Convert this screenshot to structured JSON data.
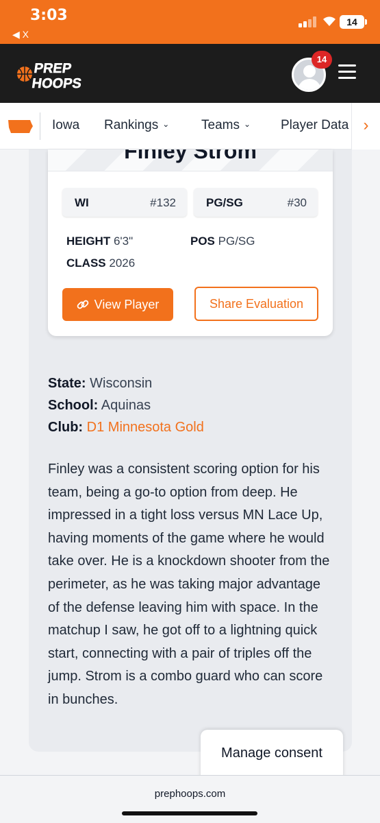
{
  "status_bar": {
    "time": "3:03",
    "back_label": "◀ X",
    "battery": "14"
  },
  "header": {
    "logo_line1": "PREP",
    "logo_line2": "HOOPS",
    "notification_count": "14"
  },
  "nav": {
    "items": [
      {
        "label": "Iowa",
        "has_dropdown": false
      },
      {
        "label": "Rankings",
        "has_dropdown": true
      },
      {
        "label": "Teams",
        "has_dropdown": true
      },
      {
        "label": "Player Data",
        "has_dropdown": false
      }
    ],
    "chevron": "›"
  },
  "player_card": {
    "name": "Finley Strom",
    "state_abbr": "WI",
    "state_rank": "#132",
    "position_label": "PG/SG",
    "position_rank": "#30",
    "height_label": "HEIGHT",
    "height_value": "6'3\"",
    "class_label": "CLASS",
    "class_value": "2026",
    "pos_label": "POS",
    "pos_value": "PG/SG",
    "view_button": "View Player",
    "share_button": "Share Evaluation"
  },
  "details": {
    "state_label": "State:",
    "state_value": "Wisconsin",
    "school_label": "School:",
    "school_value": "Aquinas",
    "club_label": "Club:",
    "club_value": "D1 Minnesota Gold"
  },
  "evaluation": "Finley was a consistent scoring option for his team, being a go-to option from deep. He impressed in a tight loss versus MN Lace Up, having moments of the game where he would take over. He is a knockdown shooter from the perimeter, as he was taking major advantage of the defense leaving him with space. In the matchup I saw, he got off to a lightning quick start, connecting with a pair of triples off the jump. Strom is a combo guard who can score in bunches.",
  "consent_button": "Manage consent",
  "browser": {
    "url": "prephoops.com"
  },
  "colors": {
    "accent": "#f2711c",
    "header_bg": "#1c1c1c",
    "badge": "#dc2626"
  }
}
